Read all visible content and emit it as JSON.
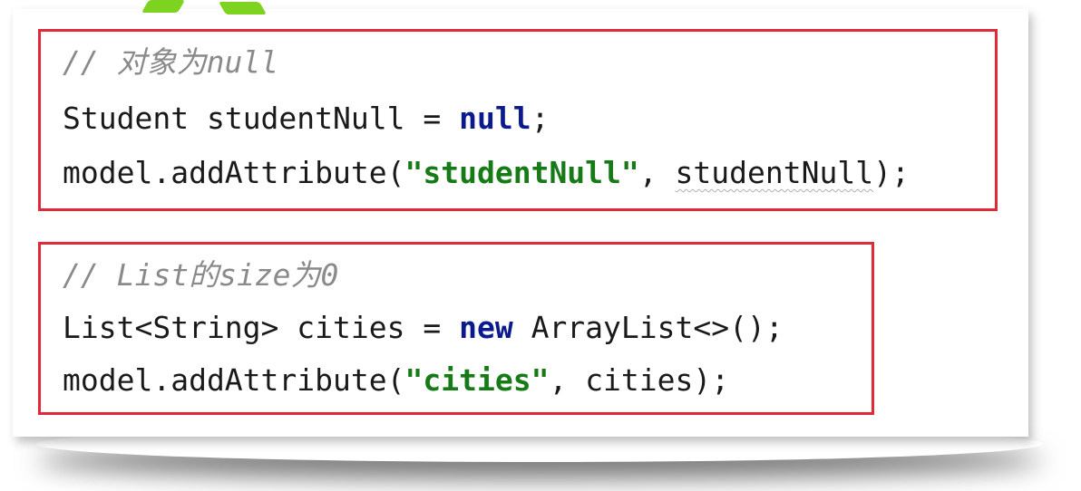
{
  "colors": {
    "frame": "#e02a3a",
    "comment": "#8a8a8a",
    "keyword": "#0b1a8c",
    "string": "#167a16",
    "text": "#1a1a1a",
    "watermark": "#7ed321"
  },
  "block1": {
    "comment": "// 对象为null",
    "line2": {
      "type": "Student",
      "var": "studentNull",
      "eq": "=",
      "kw": "null",
      "end": ";"
    },
    "line3": {
      "prefix": "model.addAttribute(",
      "str": "\"studentNull\"",
      "sep": ", ",
      "arg": "studentNull",
      "end": ");"
    }
  },
  "block2": {
    "comment": "// List的size为0",
    "line2": {
      "prefix": "List<String> cities = ",
      "kw": "new",
      "rest": " ArrayList<>();"
    },
    "line3": {
      "prefix": "model.addAttribute(",
      "str": "\"cities\"",
      "rest": ", cities);"
    }
  }
}
